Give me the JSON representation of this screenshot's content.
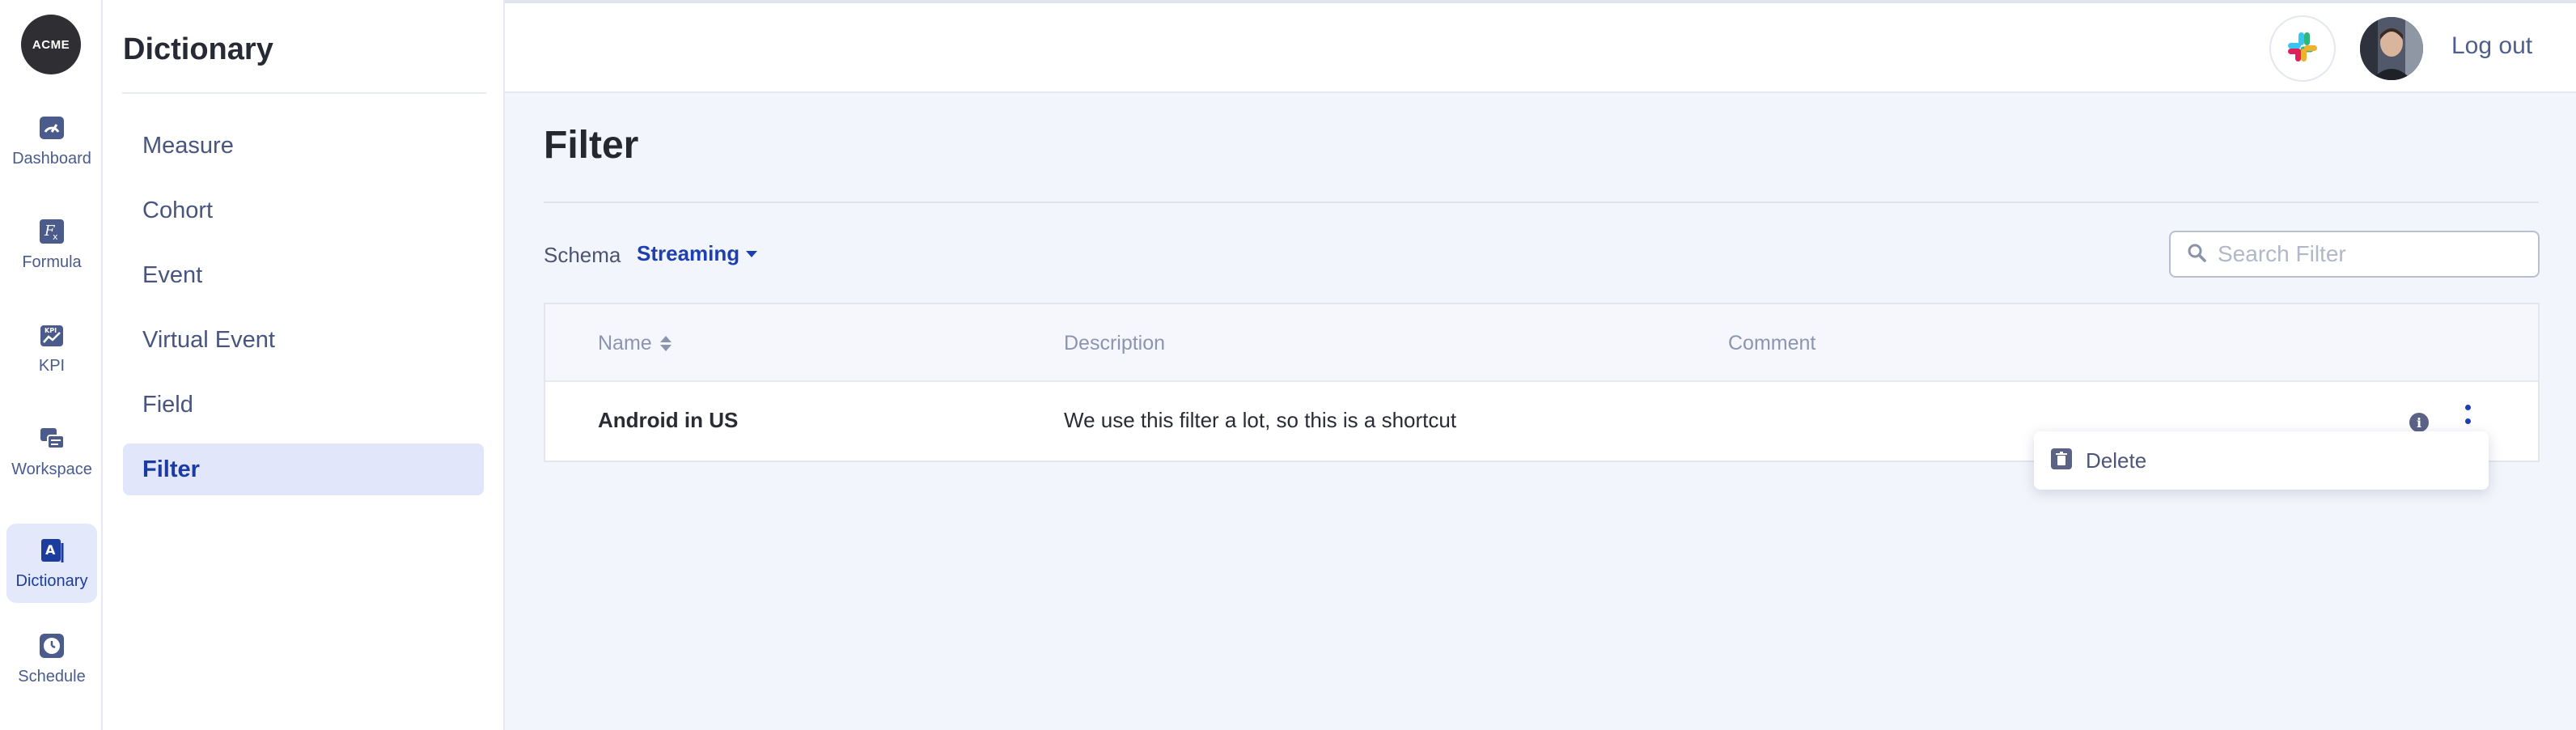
{
  "logo": {
    "text": "ACME"
  },
  "rail": {
    "items": [
      {
        "label": "Dashboard",
        "icon": "dashboard-icon",
        "active": false
      },
      {
        "label": "Formula",
        "icon": "formula-icon",
        "active": false
      },
      {
        "label": "KPI",
        "icon": "kpi-icon",
        "active": false
      },
      {
        "label": "Workspace",
        "icon": "workspace-icon",
        "active": false
      },
      {
        "label": "Dictionary",
        "icon": "dictionary-icon",
        "active": true
      },
      {
        "label": "Schedule",
        "icon": "clock-icon",
        "active": false
      }
    ]
  },
  "sidebar": {
    "title": "Dictionary",
    "items": [
      {
        "label": "Measure",
        "active": false
      },
      {
        "label": "Cohort",
        "active": false
      },
      {
        "label": "Event",
        "active": false
      },
      {
        "label": "Virtual Event",
        "active": false
      },
      {
        "label": "Field",
        "active": false
      },
      {
        "label": "Filter",
        "active": true
      }
    ]
  },
  "header": {
    "slack_icon": "slack-icon",
    "logout_label": "Log out"
  },
  "main": {
    "title": "Filter",
    "schema_label": "Schema",
    "schema_value": "Streaming",
    "search_placeholder": "Search Filter",
    "table": {
      "columns": [
        "Name",
        "Description",
        "Comment"
      ],
      "rows": [
        {
          "name": "Android in US",
          "description": "We use this filter a lot, so this is a shortcut",
          "comment": ""
        }
      ]
    },
    "menu": {
      "delete_label": "Delete"
    }
  },
  "colors": {
    "accent": "#1d3fb0",
    "active_bg": "#e1e6fb",
    "page_bg": "#f3f5fc"
  }
}
